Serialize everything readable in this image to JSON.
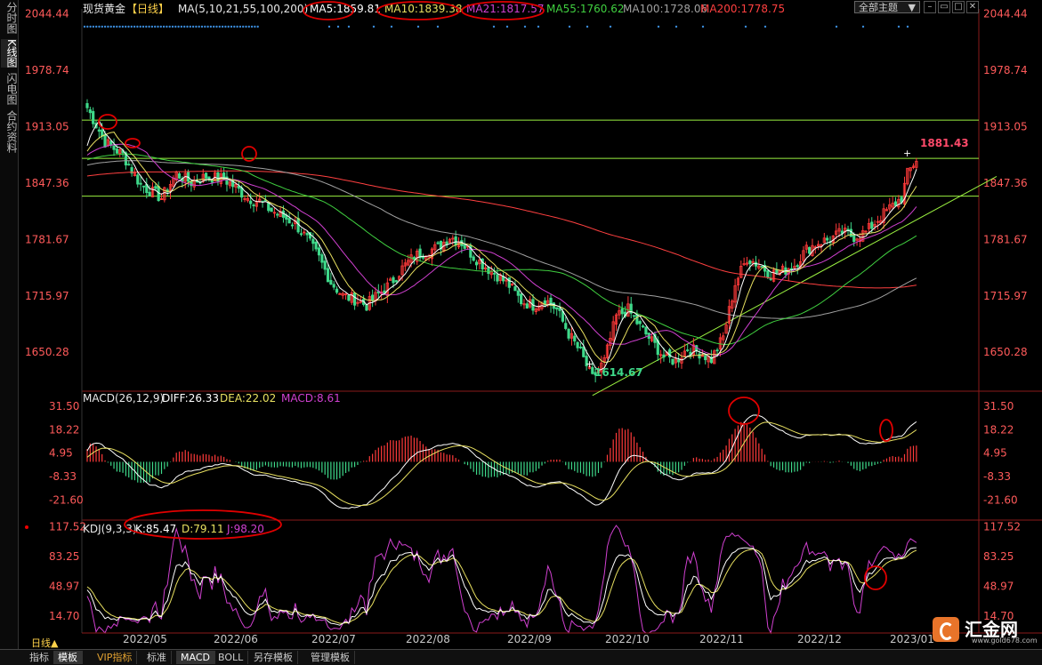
{
  "sidebar": {
    "tabs": [
      {
        "label": "分时图",
        "active": false
      },
      {
        "label": "K线图",
        "active": true
      },
      {
        "label": "闪电图",
        "active": false
      },
      {
        "label": "合约资料",
        "active": false
      }
    ]
  },
  "header": {
    "title": "现货黄金",
    "period": "【日线】",
    "ma_label": "MA(5,10,21,55,100,200)",
    "ma5": "MA5:1859.81",
    "ma10": "MA10:1839.38",
    "ma21": "MA21:1817.57",
    "ma55": "MA55:1760.62",
    "ma100": "MA100:1728.06",
    "ma200": "MA200:1778.75",
    "theme_label": "全部主题"
  },
  "colors": {
    "up": "#ff3a3a",
    "down": "#3ed98a",
    "ma5": "#ffffff",
    "ma10": "#e8e060",
    "ma21": "#d040d0",
    "ma55": "#40d040",
    "ma100": "#a0a0a0",
    "ma200": "#ff4040",
    "price_axis": "#ff5a5a",
    "support": "#9af040",
    "circle": "#e00000"
  },
  "chart_data": [
    {
      "type": "candlestick",
      "title": "现货黄金 日线",
      "x_ticks": [
        "2022/05",
        "2022/06",
        "2022/07",
        "2022/08",
        "2022/09",
        "2022/10",
        "2022/11",
        "2022/12",
        "2023/01"
      ],
      "y_ticks": [
        2044.44,
        1978.74,
        1913.05,
        1847.36,
        1781.67,
        1715.97,
        1650.28
      ],
      "ylim": [
        1605,
        2050
      ],
      "annotations": {
        "high_label": "1881.43",
        "low_label": "1614.67"
      },
      "anchors": [
        [
          0,
          1935
        ],
        [
          6,
          1895
        ],
        [
          12,
          1880
        ],
        [
          18,
          1845
        ],
        [
          25,
          1830
        ],
        [
          30,
          1858
        ],
        [
          35,
          1848
        ],
        [
          40,
          1855
        ],
        [
          46,
          1852
        ],
        [
          50,
          1842
        ],
        [
          54,
          1830
        ],
        [
          58,
          1826
        ],
        [
          62,
          1815
        ],
        [
          66,
          1808
        ],
        [
          70,
          1800
        ],
        [
          74,
          1782
        ],
        [
          78,
          1760
        ],
        [
          82,
          1732
        ],
        [
          86,
          1716
        ],
        [
          90,
          1712
        ],
        [
          94,
          1705
        ],
        [
          98,
          1718
        ],
        [
          102,
          1730
        ],
        [
          106,
          1748
        ],
        [
          110,
          1762
        ],
        [
          114,
          1768
        ],
        [
          118,
          1772
        ],
        [
          122,
          1785
        ],
        [
          126,
          1778
        ],
        [
          130,
          1762
        ],
        [
          134,
          1750
        ],
        [
          138,
          1740
        ],
        [
          142,
          1728
        ],
        [
          146,
          1710
        ],
        [
          150,
          1705
        ],
        [
          154,
          1712
        ],
        [
          158,
          1700
        ],
        [
          162,
          1672
        ],
        [
          166,
          1650
        ],
        [
          170,
          1620
        ],
        [
          174,
          1640
        ],
        [
          178,
          1692
        ],
        [
          182,
          1700
        ],
        [
          186,
          1680
        ],
        [
          190,
          1663
        ],
        [
          194,
          1645
        ],
        [
          198,
          1640
        ],
        [
          202,
          1655
        ],
        [
          206,
          1650
        ],
        [
          210,
          1642
        ],
        [
          214,
          1668
        ],
        [
          218,
          1730
        ],
        [
          222,
          1760
        ],
        [
          226,
          1752
        ],
        [
          230,
          1742
        ],
        [
          234,
          1745
        ],
        [
          238,
          1752
        ],
        [
          242,
          1770
        ],
        [
          246,
          1778
        ],
        [
          250,
          1782
        ],
        [
          254,
          1790
        ],
        [
          258,
          1785
        ],
        [
          262,
          1790
        ],
        [
          266,
          1805
        ],
        [
          270,
          1818
        ],
        [
          274,
          1830
        ],
        [
          276,
          1858
        ],
        [
          279,
          1875
        ]
      ],
      "horizontal_levels": [
        1920.5,
        1876,
        1832
      ],
      "support_line": [
        [
          170,
          1600
        ],
        [
          306,
          1855
        ]
      ]
    },
    {
      "type": "macd",
      "title": "MACD(26,12,9)",
      "params": "MACD(26,12,9)",
      "diff": "DIFF:26.33",
      "dea": "DEA:22.02",
      "macd": "MACD:8.61",
      "y_ticks": [
        31.5,
        18.22,
        4.95,
        -8.33,
        -21.6
      ],
      "ylim": [
        -33,
        40
      ]
    },
    {
      "type": "kdj",
      "title": "KDJ(9,3,3)",
      "params": "KDJ(9,3,3)",
      "k": "K:85.47",
      "d": "D:79.11",
      "j": "J:98.20",
      "y_ticks": [
        117.52,
        83.25,
        48.97,
        14.7
      ],
      "ylim": [
        -5,
        125
      ]
    }
  ],
  "toolbar": {
    "period": "日线▲",
    "items": [
      {
        "label": "指标"
      },
      {
        "label": "模板"
      },
      {
        "label": "VIP指标"
      },
      {
        "label": "标准"
      },
      {
        "label": "MACD"
      },
      {
        "label": "BOLL"
      },
      {
        "label": "另存模板"
      },
      {
        "label": "管理模板"
      }
    ]
  },
  "logo": {
    "name": "汇金网",
    "url": "www.gold678.com"
  }
}
